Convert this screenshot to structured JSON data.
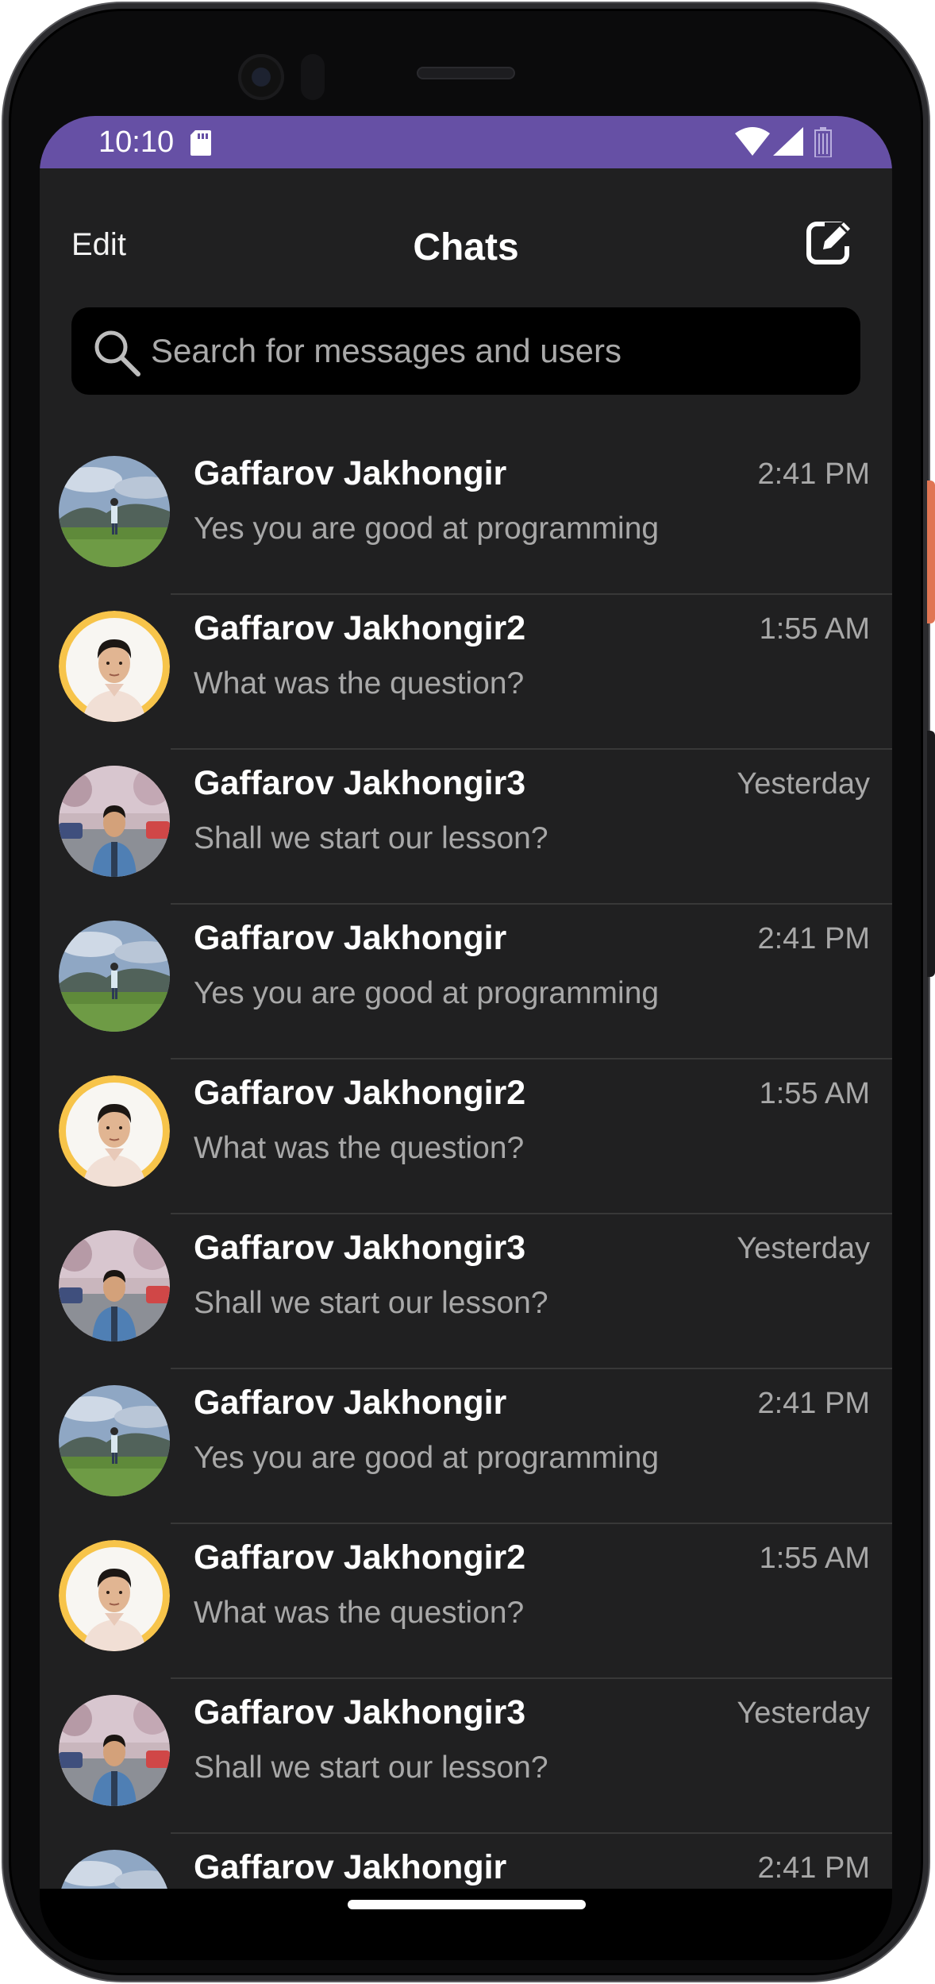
{
  "status_bar": {
    "time": "10:10",
    "icons": [
      "sd-card-icon",
      "wifi-icon",
      "signal-icon",
      "battery-icon"
    ],
    "color": "#6650a5"
  },
  "header": {
    "edit_label": "Edit",
    "title": "Chats",
    "compose_icon": "compose-icon"
  },
  "search": {
    "placeholder": "Search for messages and users",
    "icon": "search-icon"
  },
  "chats": [
    {
      "name": "Gaffarov Jakhongir",
      "time": "2:41 PM",
      "message": "Yes you are good at programming",
      "avatar": "landscape"
    },
    {
      "name": "Gaffarov Jakhongir2",
      "time": "1:55 AM",
      "message": "What was the question?",
      "avatar": "portrait"
    },
    {
      "name": "Gaffarov Jakhongir3",
      "time": "Yesterday",
      "message": "Shall we start our lesson?",
      "avatar": "street"
    },
    {
      "name": "Gaffarov Jakhongir",
      "time": "2:41 PM",
      "message": "Yes you are good at programming",
      "avatar": "landscape"
    },
    {
      "name": "Gaffarov Jakhongir2",
      "time": "1:55 AM",
      "message": "What was the question?",
      "avatar": "portrait"
    },
    {
      "name": "Gaffarov Jakhongir3",
      "time": "Yesterday",
      "message": "Shall we start our lesson?",
      "avatar": "street"
    },
    {
      "name": "Gaffarov Jakhongir",
      "time": "2:41 PM",
      "message": "Yes you are good at programming",
      "avatar": "landscape"
    },
    {
      "name": "Gaffarov Jakhongir2",
      "time": "1:55 AM",
      "message": "What was the question?",
      "avatar": "portrait"
    },
    {
      "name": "Gaffarov Jakhongir3",
      "time": "Yesterday",
      "message": "Shall we start our lesson?",
      "avatar": "street"
    },
    {
      "name": "Gaffarov Jakhongir",
      "time": "2:41 PM",
      "message": "",
      "avatar": "landscape"
    }
  ],
  "colors": {
    "background": "#202021",
    "accent": "#6650a5",
    "avatar_ring": "#f7c44a"
  }
}
